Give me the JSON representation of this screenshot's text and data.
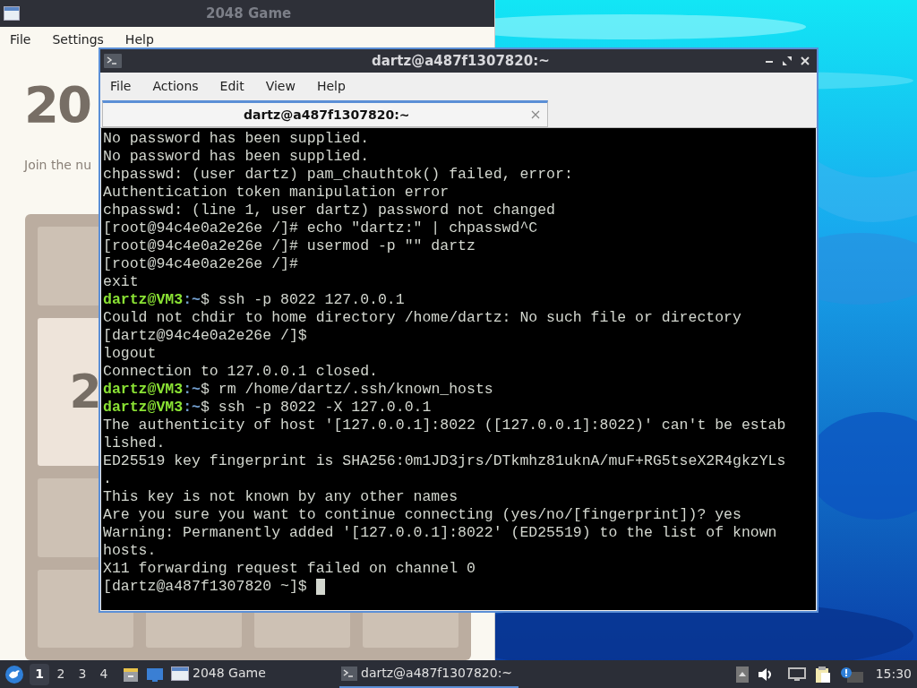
{
  "game_window": {
    "title": "2048 Game",
    "menu": [
      "File",
      "Settings",
      "Help"
    ],
    "heading": "20",
    "intro": "Join the nu",
    "tile_label": "2"
  },
  "terminal_window": {
    "title": "dartz@a487f1307820:~",
    "menu": [
      "File",
      "Actions",
      "Edit",
      "View",
      "Help"
    ],
    "tabs": [
      {
        "label": "dartz@a487f1307820:~",
        "selected": true
      }
    ],
    "lines": [
      {
        "kind": "output",
        "text": "No password has been supplied."
      },
      {
        "kind": "output",
        "text": "No password has been supplied."
      },
      {
        "kind": "output",
        "text": "chpasswd: (user dartz) pam_chauthtok() failed, error:"
      },
      {
        "kind": "output",
        "text": "Authentication token manipulation error"
      },
      {
        "kind": "output",
        "text": "chpasswd: (line 1, user dartz) password not changed"
      },
      {
        "kind": "output",
        "text": "[root@94c4e0a2e26e /]# echo \"dartz:\" | chpasswd^C"
      },
      {
        "kind": "output",
        "text": "[root@94c4e0a2e26e /]# usermod -p \"\" dartz"
      },
      {
        "kind": "output",
        "text": "[root@94c4e0a2e26e /]#"
      },
      {
        "kind": "output",
        "text": "exit"
      },
      {
        "kind": "prompt",
        "user": "dartz@VM3",
        "path": ":~",
        "command": "$ ssh -p 8022 127.0.0.1"
      },
      {
        "kind": "output",
        "text": "Could not chdir to home directory /home/dartz: No such file or directory"
      },
      {
        "kind": "output",
        "text": "[dartz@94c4e0a2e26e /]$"
      },
      {
        "kind": "output",
        "text": "logout"
      },
      {
        "kind": "output",
        "text": "Connection to 127.0.0.1 closed."
      },
      {
        "kind": "prompt",
        "user": "dartz@VM3",
        "path": ":~",
        "command": "$ rm /home/dartz/.ssh/known_hosts"
      },
      {
        "kind": "prompt",
        "user": "dartz@VM3",
        "path": ":~",
        "command": "$ ssh -p 8022 -X 127.0.0.1"
      },
      {
        "kind": "output",
        "text": "The authenticity of host '[127.0.0.1]:8022 ([127.0.0.1]:8022)' can't be estab"
      },
      {
        "kind": "output",
        "text": "lished."
      },
      {
        "kind": "output",
        "text": "ED25519 key fingerprint is SHA256:0m1JD3jrs/DTkmhz81uknA/muF+RG5tseX2R4gkzYLs"
      },
      {
        "kind": "output",
        "text": "."
      },
      {
        "kind": "output",
        "text": "This key is not known by any other names"
      },
      {
        "kind": "output",
        "text": "Are you sure you want to continue connecting (yes/no/[fingerprint])? yes"
      },
      {
        "kind": "output",
        "text": "Warning: Permanently added '[127.0.0.1]:8022' (ED25519) to the list of known"
      },
      {
        "kind": "output",
        "text": "hosts."
      },
      {
        "kind": "output",
        "text": "X11 forwarding request failed on channel 0"
      },
      {
        "kind": "cursor",
        "text": "[dartz@a487f1307820 ~]$"
      }
    ]
  },
  "taskbar": {
    "workspaces": [
      {
        "label": "1",
        "selected": true
      },
      {
        "label": "2",
        "selected": false
      },
      {
        "label": "3",
        "selected": false
      },
      {
        "label": "4",
        "selected": false
      }
    ],
    "tasks": [
      {
        "label": "2048 Game",
        "kind": "window",
        "selected": false
      },
      {
        "label": "dartz@a487f1307820:~",
        "kind": "terminal",
        "selected": true
      }
    ],
    "clock": "15:30"
  }
}
